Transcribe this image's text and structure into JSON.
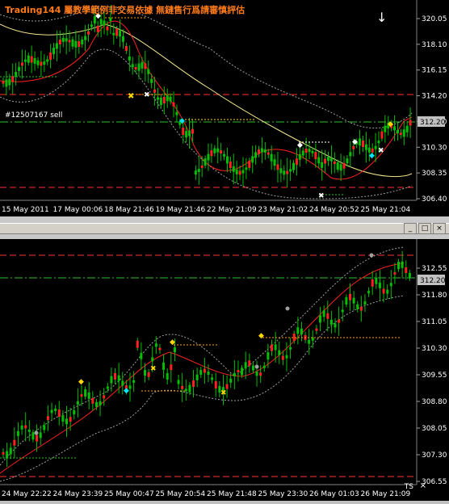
{
  "top_chart": {
    "banner": "Trading144 屬教學範例非交易依據 無鏈售行爲請審慎評估",
    "position_label": "#12507167 sell",
    "price_axis": [
      "320.05",
      "318.10",
      "316.15",
      "314.20",
      "312.20",
      "310.30",
      "308.35",
      "306.40"
    ],
    "current_price": "312.20",
    "time_axis": [
      "15 May 2011",
      "17 May 00:06",
      "18 May 21:46",
      "19 May 21:46",
      "22 May 21:09",
      "23 May 21:02",
      "24 May 20:52",
      "25 May 21:04"
    ]
  },
  "bottom_chart": {
    "indicator_label": "TS",
    "close_label": "×",
    "price_axis": [
      "312.55",
      "311.80",
      "311.05",
      "310.30",
      "309.55",
      "308.80",
      "308.05",
      "307.30",
      "306.55"
    ],
    "current_price": "312.20",
    "time_axis": [
      "24 May 22:22",
      "24 May 23:39",
      "25 May 00:47",
      "25 May 20:54",
      "25 May 21:48",
      "25 May 23:30",
      "26 May 01:03",
      "26 May 21:09"
    ]
  },
  "window_buttons": {
    "minimize": "_",
    "maximize": "□",
    "close": "×"
  },
  "colors": {
    "background": "#000000",
    "candle": "#00c000",
    "ma_red": "#ff2020",
    "ma_yellow": "#f0e68c",
    "band": "#a0a0a0",
    "level_red": "#ff3030",
    "level_green": "#30c030",
    "orange": "#ffa500"
  }
}
